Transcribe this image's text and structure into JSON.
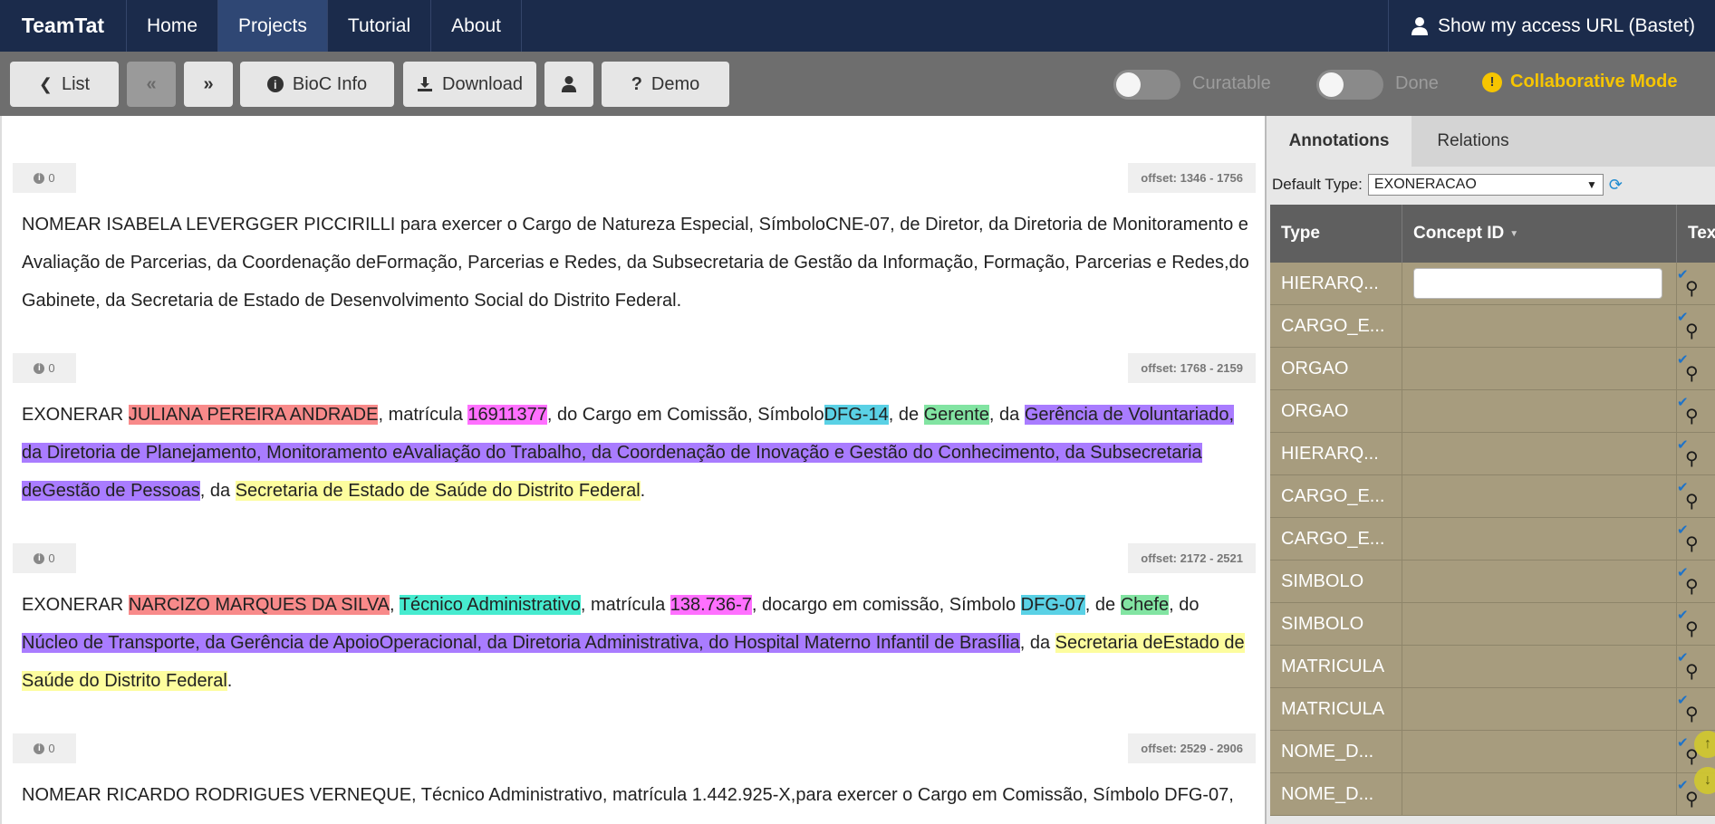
{
  "nav": {
    "brand": "TeamTat",
    "items": [
      "Home",
      "Projects",
      "Tutorial",
      "About"
    ],
    "access": "Show my access URL (Bastet)"
  },
  "toolbar": {
    "list": "List",
    "bioc": "BioC Info",
    "download": "Download",
    "demo": "Demo",
    "curatable": "Curatable",
    "done": "Done",
    "collab": "Collaborative Mode"
  },
  "passages": [
    {
      "count": "0",
      "offset": "offset: 1346 - 1756"
    },
    {
      "count": "0",
      "offset": "offset: 1768 - 2159"
    },
    {
      "count": "0",
      "offset": "offset: 2172 - 2521"
    },
    {
      "count": "0",
      "offset": "offset: 2529 - 2906"
    }
  ],
  "texts": {
    "p0": "NOMEAR ISABELA LEVERGGER PICCIRILLI para exercer o Cargo de Natureza Especial, SímboloCNE-07, de Diretor, da Diretoria de Monitoramento e Avaliação de Parcerias, da Coordenação deFormação, Parcerias e Redes, da Subsecretaria de Gestão da Informação, Formação, Parcerias e Redes,do Gabinete, da Secretaria de Estado de Desenvolvimento Social do Distrito Federal.",
    "p1": {
      "a": "EXONERAR ",
      "name": "JULIANA PEREIRA ANDRADE",
      "b": ", matrícula ",
      "mat": "16911377",
      "c": ", do Cargo em Comissão, Símbolo",
      "sim": "DFG-14",
      "d": ", de ",
      "cargo": "Gerente",
      "e": ", da ",
      "hier": "Gerência de Voluntariado, da Diretoria de Planejamento, Monitoramento eAvaliação do Trabalho, da Coordenação de Inovação e Gestão do Conhecimento, da Subsecretaria deGestão de Pessoas",
      "f": ", da ",
      "org": "Secretaria de Estado de Saúde do Distrito Federal",
      "g": "."
    },
    "p2": {
      "a": "EXONERAR ",
      "name": "NARCIZO MARQUES DA SILVA",
      "b": ", ",
      "tec": "Técnico Administrativo",
      "c": ", matrícula ",
      "mat": "138.736-7",
      "d": ", docargo em comissão, Símbolo ",
      "sim": "DFG-07",
      "e": ", de ",
      "cargo": "Chefe",
      "f": ", do ",
      "hier": "Núcleo de Transporte, da Gerência de ApoioOperacional, da Diretoria Administrativa, do Hospital Materno Infantil de Brasília",
      "g": ", da ",
      "org": "Secretaria deEstado de Saúde do Distrito Federal",
      "h": "."
    },
    "p3": "NOMEAR RICARDO RODRIGUES VERNEQUE, Técnico Administrativo, matrícula 1.442.925-X,para exercer o Cargo em Comissão, Símbolo DFG-07,"
  },
  "panel": {
    "tab_annotations": "Annotations",
    "tab_relations": "Relations",
    "default_type_label": "Default Type:",
    "default_type_value": "EXONERACAO",
    "col_type": "Type",
    "col_concept": "Concept ID",
    "col_text": "Tex",
    "rows": [
      "HIERARQ...",
      "CARGO_E...",
      "ORGAO",
      "ORGAO",
      "HIERARQ...",
      "CARGO_E...",
      "CARGO_E...",
      "SIMBOLO",
      "SIMBOLO",
      "MATRICULA",
      "MATRICULA",
      "NOME_D...",
      "NOME_D..."
    ]
  },
  "colors": {
    "nav_bg": "#1b2b4b",
    "toolbar_bg": "#6e6e6e",
    "row_bg": "#a79c7e",
    "collab": "#f6c500"
  }
}
